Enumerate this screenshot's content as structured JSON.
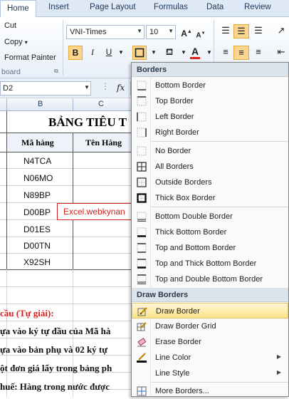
{
  "ribbon": {
    "tabs": [
      "Home",
      "Insert",
      "Page Layout",
      "Formulas",
      "Data",
      "Review"
    ],
    "clipboard": {
      "cut": "Cut",
      "copy": "Copy",
      "format_painter": "Format Painter",
      "group_label": "board"
    },
    "font": {
      "name": "VNI-Times",
      "size": "10",
      "bold": "B",
      "italic": "I",
      "underline": "U",
      "grow": "A",
      "shrink": "A"
    }
  },
  "formula_bar": {
    "name_box": "D2",
    "fx": "fx"
  },
  "columns": [
    "B",
    "C"
  ],
  "sheet": {
    "title": "BẢNG TIÊU T",
    "headers": [
      "Mã hàng",
      "Tên Hàng"
    ],
    "codes": [
      "N4TCA",
      "N06MO",
      "N89BP",
      "D00BP",
      "D01ES",
      "D00TN",
      "X92SH"
    ],
    "tooltip": "Excel.webkynan",
    "task_heading": "cầu (Tự giải):",
    "lines": [
      "ựa vào ký tự đầu của Mã hà",
      "ựa vào bản phụ và 02 ký tự",
      "ột đơn giá lấy trong bảng ph",
      "huế: Hàng trong nước được"
    ]
  },
  "menu": {
    "section_borders": "Borders",
    "section_draw": "Draw Borders",
    "items": [
      {
        "label": "Bottom Border",
        "icon": "bottom-border-icon"
      },
      {
        "label": "Top Border",
        "icon": "top-border-icon"
      },
      {
        "label": "Left Border",
        "icon": "left-border-icon"
      },
      {
        "label": "Right Border",
        "icon": "right-border-icon"
      },
      {
        "label": "No Border",
        "icon": "no-border-icon"
      },
      {
        "label": "All Borders",
        "icon": "all-borders-icon"
      },
      {
        "label": "Outside Borders",
        "icon": "outside-borders-icon"
      },
      {
        "label": "Thick Box Border",
        "icon": "thick-box-border-icon"
      },
      {
        "label": "Bottom Double Border",
        "icon": "bottom-double-border-icon"
      },
      {
        "label": "Thick Bottom Border",
        "icon": "thick-bottom-border-icon"
      },
      {
        "label": "Top and Bottom Border",
        "icon": "top-bottom-border-icon"
      },
      {
        "label": "Top and Thick Bottom Border",
        "icon": "top-thick-bottom-border-icon"
      },
      {
        "label": "Top and Double Bottom Border",
        "icon": "top-double-bottom-border-icon"
      }
    ],
    "draw_items": [
      {
        "label": "Draw Border",
        "icon": "pencil-icon"
      },
      {
        "label": "Draw Border Grid",
        "icon": "pencil-grid-icon"
      },
      {
        "label": "Erase Border",
        "icon": "eraser-icon"
      },
      {
        "label": "Line Color",
        "icon": "line-color-icon"
      },
      {
        "label": "Line Style",
        "icon": "line-style-icon"
      }
    ],
    "more": {
      "label": "More Borders...",
      "icon": "more-borders-icon"
    }
  },
  "colors": {
    "accent": "#fbd68e",
    "font_color": "#e0201c",
    "tooltip": "#d02020"
  }
}
